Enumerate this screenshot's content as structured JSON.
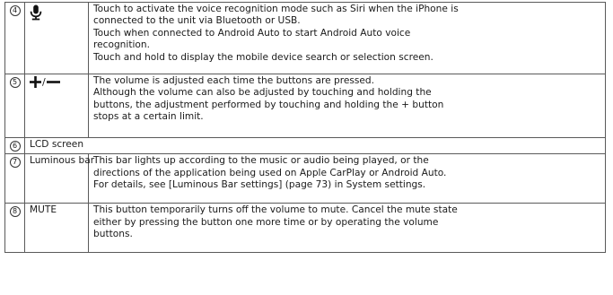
{
  "rows": [
    {
      "num": "4",
      "icon": "microphone-icon",
      "lines": [
        "Touch to activate the voice recognition mode such as Siri when the iPhone is",
        "connected to the unit via Bluetooth or USB.",
        "Touch when connected to Android Auto to start Android Auto voice",
        "recognition.",
        "Touch and hold to display the mobile device search or selection screen."
      ]
    },
    {
      "num": "5",
      "icon": "plus-minus-icon",
      "slash": "/",
      "lines": [
        "The volume is adjusted each time the buttons are pressed.",
        "Although the volume can also be adjusted by touching and holding the",
        "buttons, the adjustment performed by touching and holding the + button",
        "stops at a certain limit."
      ]
    },
    {
      "num": "6",
      "label": "LCD screen"
    },
    {
      "num": "7",
      "label": "Luminous bar",
      "lines": [
        "This bar lights up according to the music or audio being played, or the",
        "directions of the application being used on Apple CarPlay or Android Auto.",
        "For details, see [Luminous Bar settings] (page 73) in System settings."
      ]
    },
    {
      "num": "8",
      "label": "MUTE",
      "lines": [
        "This button temporarily turns off the volume to mute. Cancel the mute state",
        "either by pressing the button one more time or by operating the volume",
        "buttons."
      ]
    }
  ]
}
